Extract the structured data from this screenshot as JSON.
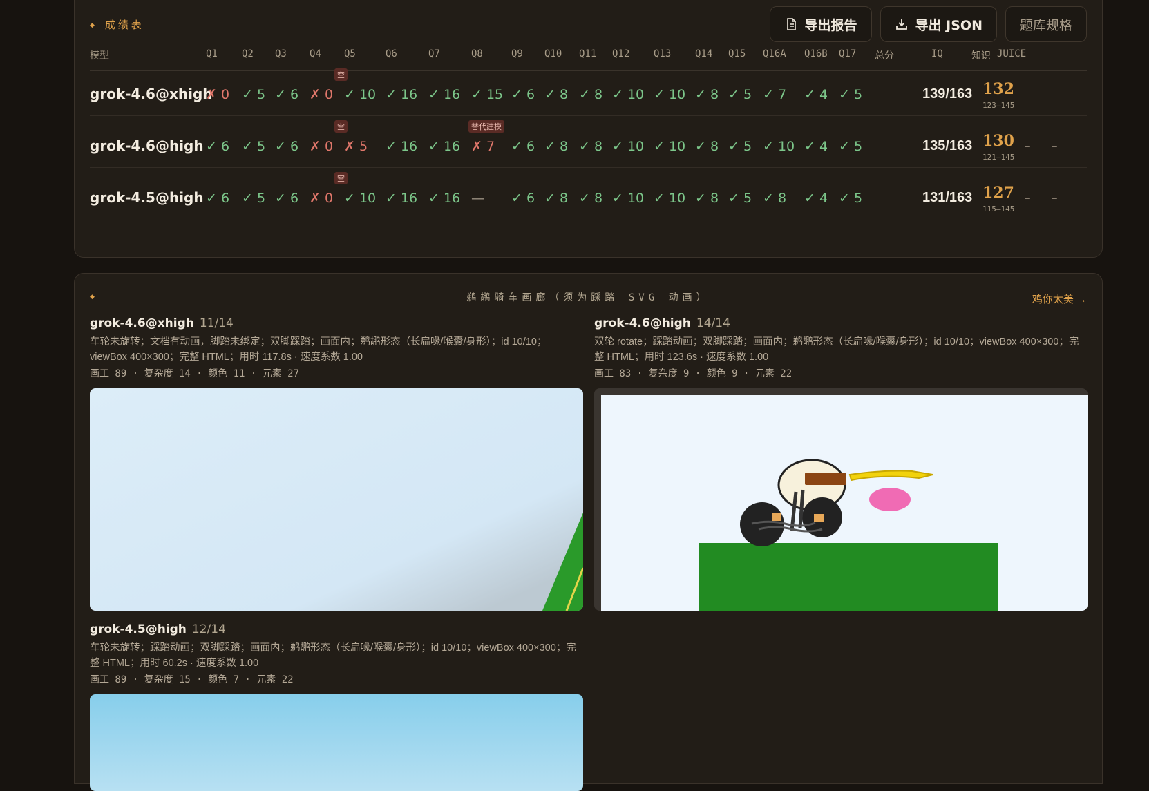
{
  "scoreboard": {
    "title": "成绩表",
    "buttons": {
      "export_report": "导出报告",
      "export_json": "导出 JSON",
      "spec": "题库规格"
    },
    "columns": [
      "模型",
      "Q1",
      "Q2",
      "Q3",
      "Q4",
      "Q5",
      "Q6",
      "Q7",
      "Q8",
      "Q9",
      "Q10",
      "Q11",
      "Q12",
      "Q13",
      "Q14",
      "Q15",
      "Q16A",
      "Q16B",
      "Q17",
      "总分",
      "IQ",
      "知识",
      "JUICE"
    ],
    "rows": [
      {
        "model": "grok-4.6@xhigh",
        "cells": [
          "✗ 0",
          "✓ 5",
          "✓ 6",
          "✗ 0",
          "✓ 10",
          "✓ 16",
          "✓ 16",
          "✓ 15",
          "✓ 6",
          "✓ 8",
          "✓ 8",
          "✓ 10",
          "✓ 10",
          "✓ 8",
          "✓ 5",
          "✓ 7",
          "✓ 4",
          "✓ 5"
        ],
        "status": [
          "bad",
          "ok",
          "ok",
          "bad",
          "ok",
          "ok",
          "ok",
          "ok",
          "ok",
          "ok",
          "ok",
          "ok",
          "ok",
          "ok",
          "ok",
          "ok",
          "ok",
          "ok"
        ],
        "tags": {
          "q5": "空"
        },
        "total": "139/163",
        "iq": "132",
        "iq_range": "123–145",
        "knowledge": "–",
        "juice": "–"
      },
      {
        "model": "grok-4.6@high",
        "cells": [
          "✓ 6",
          "✓ 5",
          "✓ 6",
          "✗ 0",
          "✗ 5",
          "✓ 16",
          "✓ 16",
          "✗ 7",
          "✓ 6",
          "✓ 8",
          "✓ 8",
          "✓ 10",
          "✓ 10",
          "✓ 8",
          "✓ 5",
          "✓ 10",
          "✓ 4",
          "✓ 5"
        ],
        "status": [
          "ok",
          "ok",
          "ok",
          "bad",
          "bad",
          "ok",
          "ok",
          "bad",
          "ok",
          "ok",
          "ok",
          "ok",
          "ok",
          "ok",
          "ok",
          "ok",
          "ok",
          "ok"
        ],
        "tags": {
          "q5": "空",
          "q8": "替代建模"
        },
        "total": "135/163",
        "iq": "130",
        "iq_range": "121–145",
        "knowledge": "–",
        "juice": "–"
      },
      {
        "model": "grok-4.5@high",
        "cells": [
          "✓ 6",
          "✓ 5",
          "✓ 6",
          "✗ 0",
          "✓ 10",
          "✓ 16",
          "✓ 16",
          "—",
          "✓ 6",
          "✓ 8",
          "✓ 8",
          "✓ 10",
          "✓ 10",
          "✓ 8",
          "✓ 5",
          "✓ 8",
          "✓ 4",
          "✓ 5"
        ],
        "status": [
          "ok",
          "ok",
          "ok",
          "bad",
          "ok",
          "ok",
          "ok",
          "none",
          "ok",
          "ok",
          "ok",
          "ok",
          "ok",
          "ok",
          "ok",
          "ok",
          "ok",
          "ok"
        ],
        "tags": {
          "q5": "空"
        },
        "total": "131/163",
        "iq": "127",
        "iq_range": "115–145",
        "knowledge": "–",
        "juice": "–"
      }
    ]
  },
  "gallery": {
    "title": "鹈鹕骑车画廊（须为踩踏 SVG 动画）",
    "link": "鸡你太美 →",
    "cards": [
      {
        "model": "grok-4.6@xhigh",
        "score": "11/14",
        "desc": "车轮未旋转；文档有动画，脚踏未绑定；双脚踩踏；画面内；鹈鹕形态（长扁喙/喉囊/身形）；id 10/10；viewBox 400×300；完整 HTML；用时 117.8s · 速度系数 1.00",
        "meta": "画工 89 · 复杂度 14 · 颜色 11 · 元素 27"
      },
      {
        "model": "grok-4.6@high",
        "score": "14/14",
        "desc": "双轮 rotate；踩踏动画；双脚踩踏；画面内；鹈鹕形态（长扁喙/喉囊/身形）；id 10/10；viewBox 400×300；完整 HTML；用时 123.6s · 速度系数 1.00",
        "meta": "画工 83 · 复杂度 9 · 颜色 9 · 元素 22"
      },
      {
        "model": "grok-4.5@high",
        "score": "12/14",
        "desc": "车轮未旋转；踩踏动画；双脚踩踏；画面内；鹈鹕形态（长扁喙/喉囊/身形）；id 10/10；viewBox 400×300；完整 HTML；用时 60.2s · 速度系数 1.00",
        "meta": "画工 89 · 复杂度 15 · 颜色 7 · 元素 22"
      }
    ]
  }
}
